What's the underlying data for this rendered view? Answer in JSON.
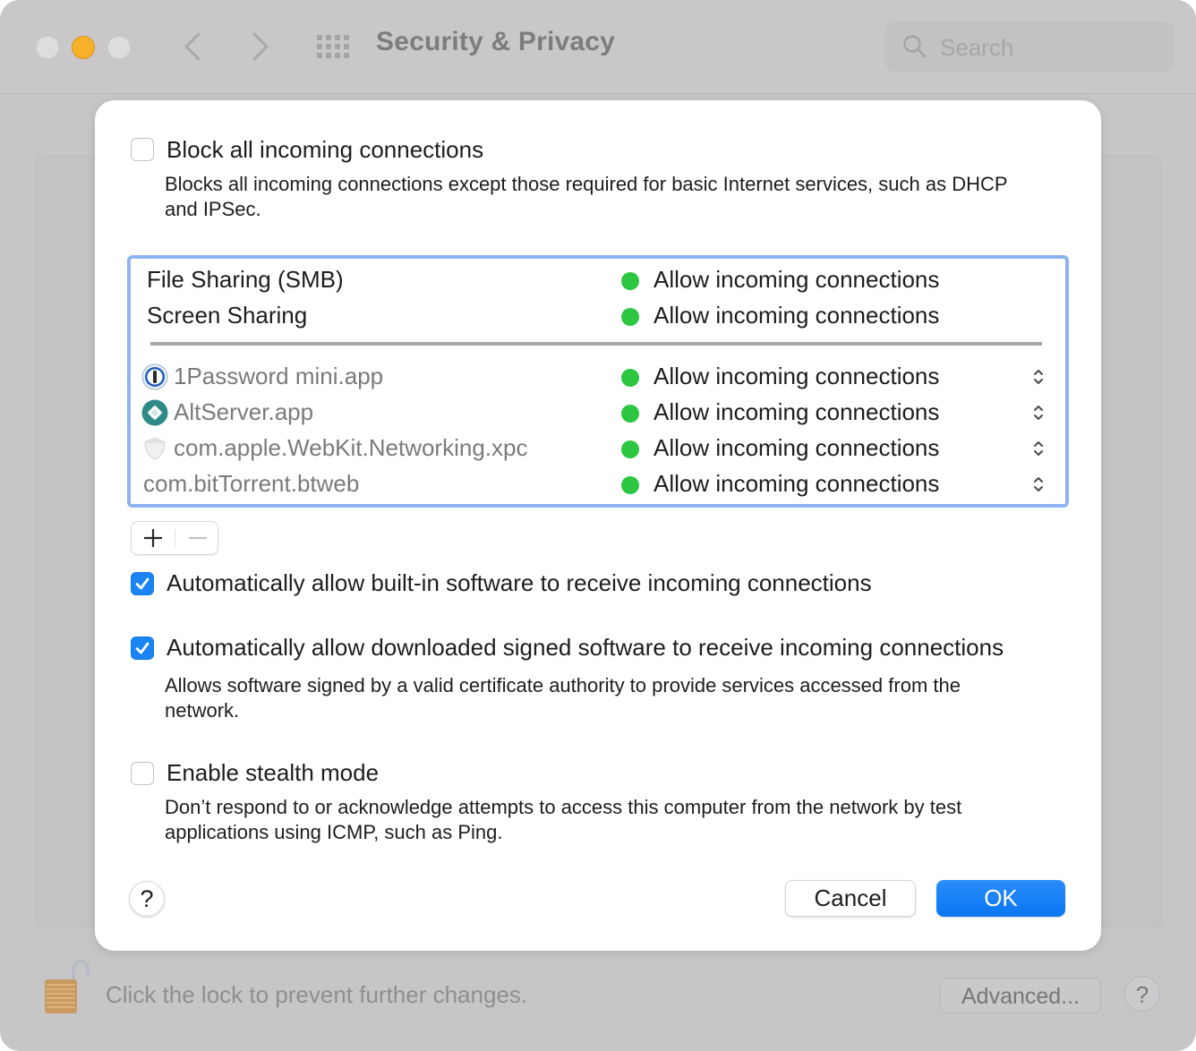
{
  "window": {
    "title": "Security & Privacy",
    "search_placeholder": "Search",
    "lock_text": "Click the lock to prevent further changes.",
    "advanced_label": "Advanced...",
    "help_label": "?"
  },
  "sheet": {
    "block_all": {
      "label": "Block all incoming connections",
      "checked": false,
      "description": "Blocks all incoming connections except those required for basic Internet services, such as DHCP and IPSec."
    },
    "services": [
      {
        "name": "File Sharing (SMB)",
        "status": "Allow incoming connections",
        "status_color": "#2cc640"
      },
      {
        "name": "Screen Sharing",
        "status": "Allow incoming connections",
        "status_color": "#2cc640"
      }
    ],
    "apps": [
      {
        "name": "1Password mini.app",
        "icon": "1password-icon",
        "status": "Allow incoming connections",
        "status_color": "#2cc640"
      },
      {
        "name": "AltServer.app",
        "icon": "altserver-icon",
        "status": "Allow incoming connections",
        "status_color": "#2cc640"
      },
      {
        "name": "com.apple.WebKit.Networking.xpc",
        "icon": "shield-icon",
        "status": "Allow incoming connections",
        "status_color": "#2cc640"
      },
      {
        "name": "com.bitTorrent.btweb",
        "icon": "",
        "status": "Allow incoming connections",
        "status_color": "#2cc640"
      }
    ],
    "add_label": "+",
    "remove_label": "−",
    "auto_builtin": {
      "label": "Automatically allow built-in software to receive incoming connections",
      "checked": true
    },
    "auto_signed": {
      "label": "Automatically allow downloaded signed software to receive incoming connections",
      "checked": true,
      "description": "Allows software signed by a valid certificate authority to provide services accessed from the network."
    },
    "stealth": {
      "label": "Enable stealth mode",
      "checked": false,
      "description": "Don’t respond to or acknowledge attempts to access this computer from the network by test applications using ICMP, such as Ping."
    },
    "help_label": "?",
    "cancel_label": "Cancel",
    "ok_label": "OK"
  },
  "colors": {
    "accent": "#1b84f5",
    "focus_ring": "#8eb3f3",
    "status_green": "#2cc640",
    "minimize": "#f7b12a"
  }
}
